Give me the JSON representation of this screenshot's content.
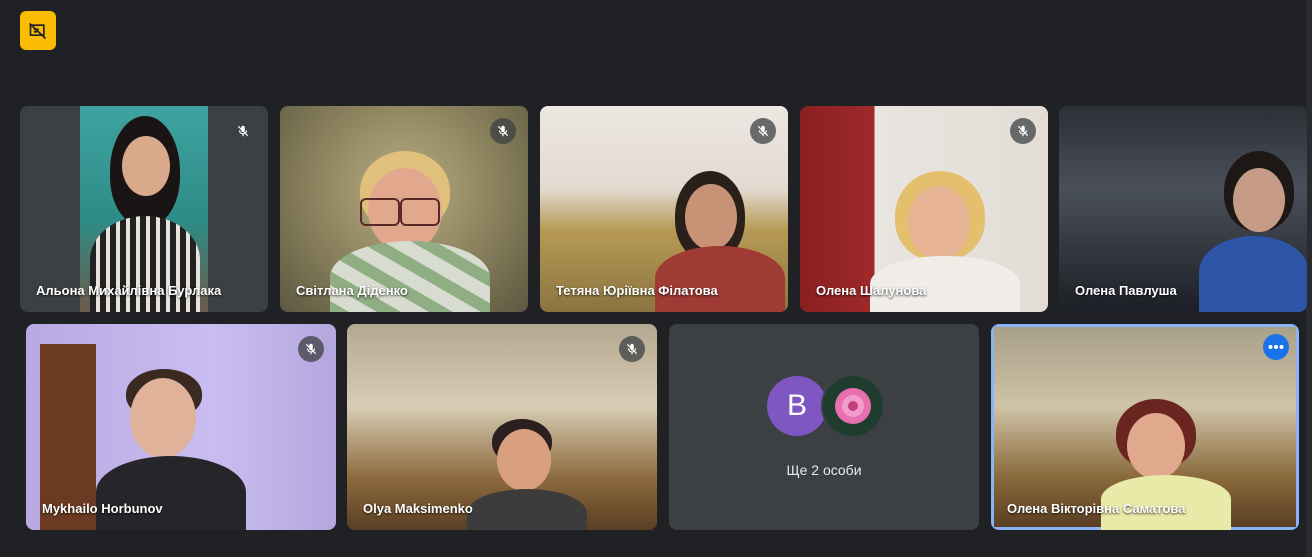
{
  "topbar": {
    "badge_icon": "presentation-off-icon",
    "badge_color": "#fbbc04"
  },
  "participants_row1": [
    {
      "name": "Альона Михайлівна Бурлака",
      "mic_muted": true
    },
    {
      "name": "Світлана Діденко",
      "mic_muted": true
    },
    {
      "name": "Тетяна Юріївна Філатова",
      "mic_muted": true
    },
    {
      "name": "Олена Шалунова",
      "mic_muted": true
    },
    {
      "name": "Олена Павлуша",
      "mic_muted": false
    }
  ],
  "participants_row2": [
    {
      "name": "Mykhailo Horbunov",
      "mic_muted": true
    },
    {
      "name": "Olya Maksimenko",
      "mic_muted": true
    }
  ],
  "others_tile": {
    "avatar_letter": "B",
    "avatar_letter_color": "#7e57c2",
    "label": "Ще 2 особи"
  },
  "self_tile": {
    "name": "Олена Вікторівна Саматова",
    "highlight_color": "#8ab4f8",
    "more_button_icon": "more-options-icon"
  }
}
